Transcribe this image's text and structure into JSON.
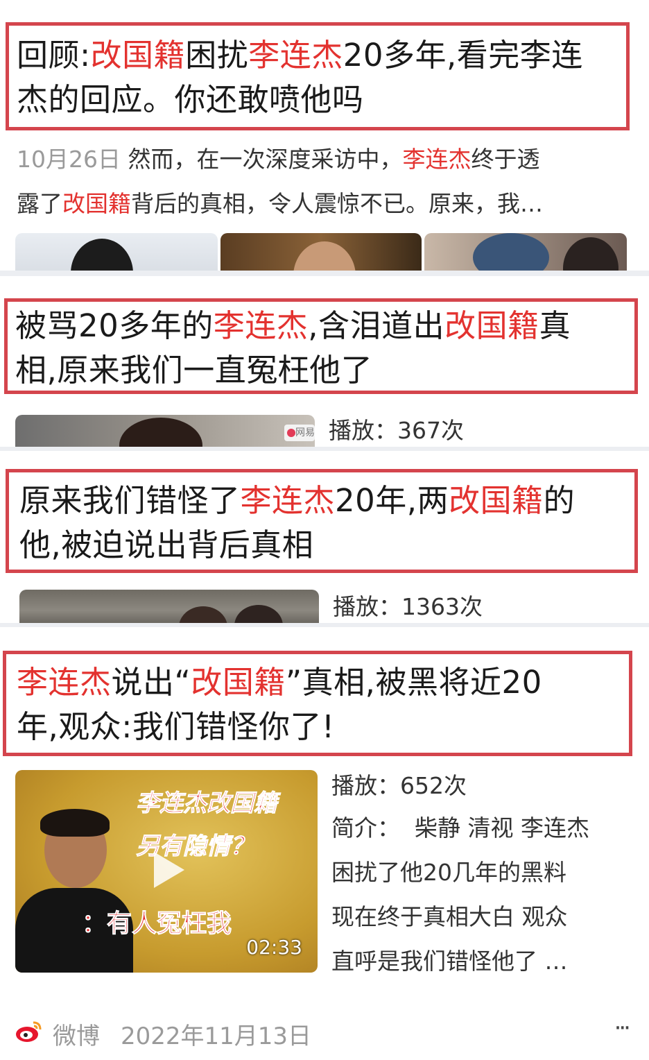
{
  "items": [
    {
      "title_parts": [
        "回顾:",
        "改国籍",
        "困扰",
        "李连杰",
        "20多年,看完李连",
        "杰的回应。你还敢喷他吗"
      ],
      "date": "10月26日",
      "snippet_parts": [
        "然而，在一次深度采访中，",
        "李连杰",
        "终于透",
        "露了",
        "改国籍",
        "背后的真相，令人震惊不已。原来，我…"
      ]
    },
    {
      "title_parts": [
        "被骂20多年的",
        "李连杰",
        ",含泪道出",
        "改国籍",
        "真",
        "相,原来我们一直冤枉他了"
      ],
      "play_label": "播放：",
      "play_count": "367次",
      "source_logo_text": "网易"
    },
    {
      "title_parts": [
        "原来我们错怪了",
        "李连杰",
        "20年,两",
        "改国籍",
        "的",
        "他,被迫说出背后真相"
      ],
      "play_label": "播放：",
      "play_count": "1363次"
    },
    {
      "title_parts": [
        "李连杰",
        "说出“",
        "改国籍",
        "”真相,被黑将近20",
        "年,观众:我们错怪你了!"
      ],
      "play_label": "播放：",
      "play_count": "652次",
      "intro_label": "简介：",
      "intro_lines": [
        "柴静 清视 李连杰",
        "困扰了他20几年的黑料",
        "现在终于真相大白 观众",
        "直呼是我们错怪他了 …"
      ],
      "thumb_caption_1": "李连杰改国籍",
      "thumb_caption_2": "另有隐情？",
      "thumb_caption_3": "：有人冤枉我",
      "duration": "02:33"
    }
  ],
  "footer": {
    "source": "微博",
    "date": "2022年11月13日",
    "more": "···"
  },
  "colors": {
    "highlight": "#e3322f",
    "box": "#d4454d"
  }
}
